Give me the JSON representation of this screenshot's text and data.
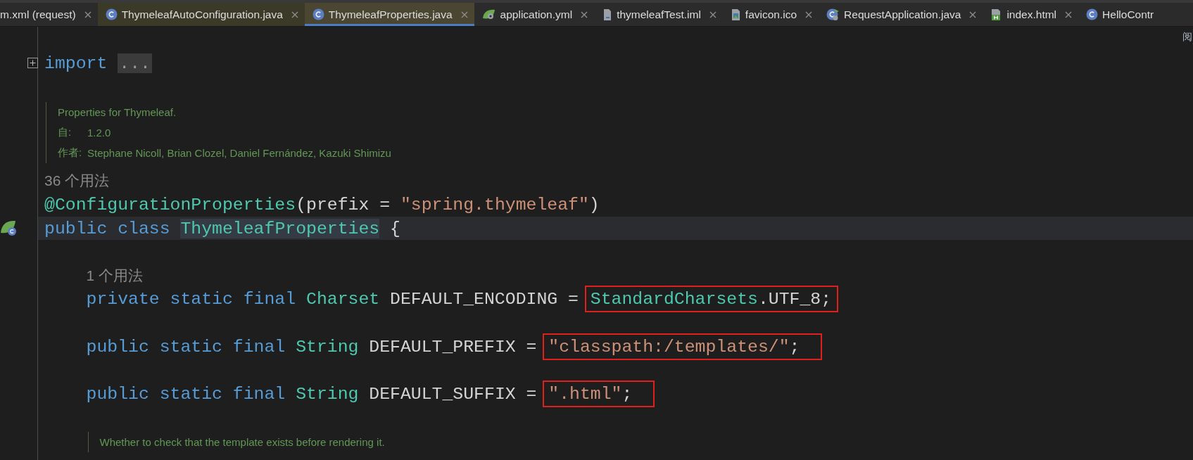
{
  "tabs": [
    {
      "label": "m.xml (request)",
      "kind": "none",
      "selected": false,
      "library": false
    },
    {
      "label": "ThymeleafAutoConfiguration.java",
      "kind": "class",
      "selected": false,
      "library": true
    },
    {
      "label": "ThymeleafProperties.java",
      "kind": "class",
      "selected": true,
      "library": true
    },
    {
      "label": "application.yml",
      "kind": "spring",
      "selected": false,
      "library": false
    },
    {
      "label": "thymeleafTest.iml",
      "kind": "module",
      "selected": false,
      "library": false
    },
    {
      "label": "favicon.ico",
      "kind": "image",
      "selected": false,
      "library": false
    },
    {
      "label": "RequestApplication.java",
      "kind": "app",
      "selected": false,
      "library": false
    },
    {
      "label": "index.html",
      "kind": "html",
      "selected": false,
      "library": false
    },
    {
      "label": "HelloContr",
      "kind": "class",
      "selected": false,
      "library": false
    }
  ],
  "reader_mode": "阅",
  "editor": {
    "lines": [
      {
        "kind": "fold",
        "segments": [
          {
            "kind": "keyword",
            "text": "import"
          }
        ],
        "folded": "..."
      },
      {
        "kind": "doc",
        "entries": [
          {
            "text": "Properties for Thymeleaf."
          },
          {
            "label": "自:",
            "text": "1.2.0"
          },
          {
            "label": "作者:",
            "text": "Stephane Nicoll, Brian Clozel, Daniel Fernández, Kazuki Shimizu"
          }
        ]
      },
      {
        "kind": "usages",
        "text": "36 个用法"
      },
      {
        "kind": "code",
        "current": false,
        "segments": [
          {
            "kind": "annotation",
            "text": "@ConfigurationProperties"
          },
          {
            "kind": "plain",
            "text": "(prefix = "
          },
          {
            "kind": "string",
            "text": "\"spring.thymeleaf\""
          },
          {
            "kind": "plain",
            "text": ")"
          }
        ]
      },
      {
        "kind": "code",
        "current": true,
        "gutter": {
          "kind": "bean"
        },
        "segments": [
          {
            "kind": "keyword",
            "text": "public class "
          },
          {
            "kind": "type",
            "text": "ThymeleafProperties",
            "highlighted": true
          },
          {
            "kind": "plain",
            "text": " {"
          }
        ],
        "children": [
          {
            "kind": "blank"
          },
          {
            "kind": "usages",
            "text": "1 个用法"
          },
          {
            "kind": "code",
            "current": false,
            "segments": [
              {
                "kind": "keyword",
                "text": "private static final "
              },
              {
                "kind": "type",
                "text": "Charset"
              },
              {
                "kind": "plain",
                "text": " DEFAULT_ENCODING = "
              },
              {
                "kind": "marked",
                "segments": [
                  {
                    "kind": "type",
                    "text": "StandardCharsets"
                  },
                  {
                    "kind": "plain",
                    "text": ".UTF_8;"
                  }
                ]
              }
            ]
          },
          {
            "kind": "blank"
          },
          {
            "kind": "code",
            "current": false,
            "segments": [
              {
                "kind": "keyword",
                "text": "public static final "
              },
              {
                "kind": "type",
                "text": "String"
              },
              {
                "kind": "plain",
                "text": " DEFAULT_PREFIX = "
              },
              {
                "kind": "marked",
                "segments": [
                  {
                    "kind": "string",
                    "text": "\"classpath:/templates/\""
                  },
                  {
                    "kind": "plain",
                    "text": ";"
                  }
                ]
              }
            ]
          },
          {
            "kind": "blank"
          },
          {
            "kind": "code",
            "current": false,
            "segments": [
              {
                "kind": "keyword",
                "text": "public static final "
              },
              {
                "kind": "type",
                "text": "String"
              },
              {
                "kind": "plain",
                "text": " DEFAULT_SUFFIX = "
              },
              {
                "kind": "marked",
                "segments": [
                  {
                    "kind": "string",
                    "text": "\".html\""
                  },
                  {
                    "kind": "plain",
                    "text": ";"
                  }
                ]
              }
            ]
          },
          {
            "kind": "blank"
          },
          {
            "kind": "doc",
            "entries": [
              {
                "text": "Whether to check that the template exists before rendering it."
              }
            ]
          }
        ]
      }
    ]
  }
}
